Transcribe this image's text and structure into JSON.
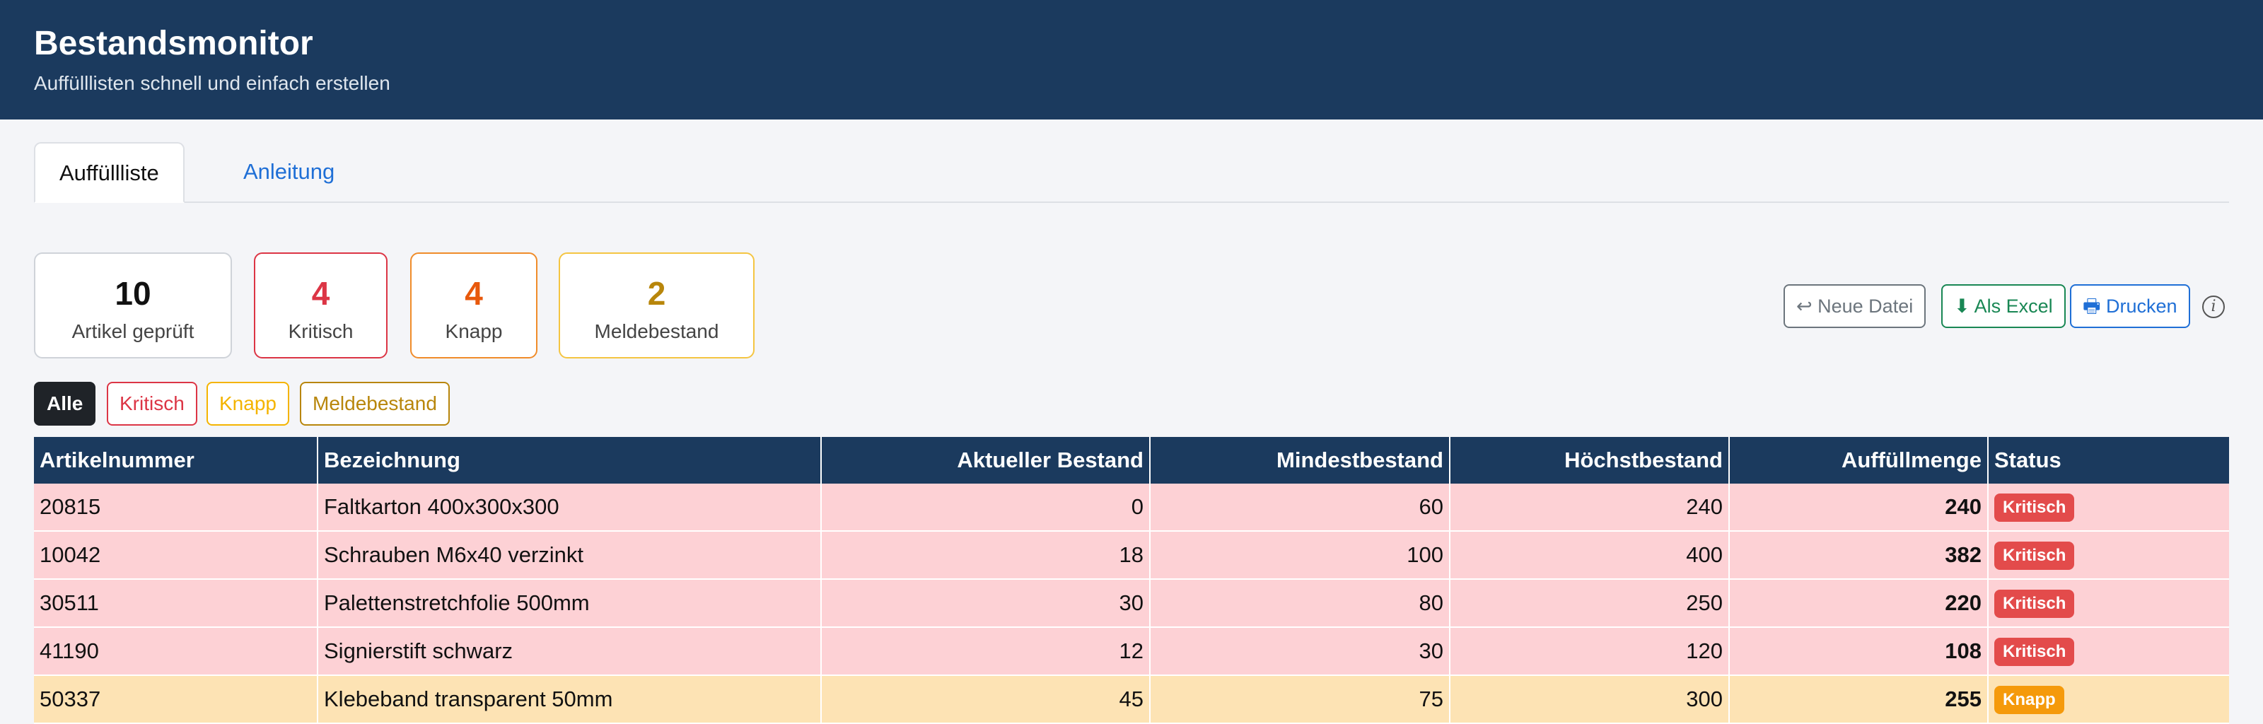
{
  "header": {
    "title": "Bestandsmonitor",
    "subtitle": "Auffülllisten schnell und einfach erstellen"
  },
  "tabs": [
    {
      "label": "Auffüllliste",
      "active": true
    },
    {
      "label": "Anleitung",
      "active": false
    }
  ],
  "summary": [
    {
      "value": "10",
      "label": "Artikel geprüft",
      "color": "#111111",
      "border": "#cfd3d9"
    },
    {
      "value": "4",
      "label": "Kritisch",
      "color": "#dc3545",
      "border": "#dc3545"
    },
    {
      "value": "4",
      "label": "Knapp",
      "color": "#e8590c",
      "border": "#f08c2a"
    },
    {
      "value": "2",
      "label": "Meldebestand",
      "color": "#b8860b",
      "border": "#f4c542"
    }
  ],
  "filters": [
    {
      "label": "Alle",
      "active": true
    },
    {
      "label": "Kritisch",
      "color": "#dc3545"
    },
    {
      "label": "Knapp",
      "color": "#f4b400"
    },
    {
      "label": "Meldebestand",
      "color": "#b8860b"
    }
  ],
  "actions": {
    "new_file": "↩ Neue Datei",
    "excel": "⬇ Als Excel",
    "print": "🖶 Drucken",
    "info": "i"
  },
  "table": {
    "columns": [
      "Artikelnummer",
      "Bezeichnung",
      "Aktueller Bestand",
      "Mindestbestand",
      "Höchstbestand",
      "Auffüllmenge",
      "Status"
    ],
    "rows": [
      {
        "id": "20815",
        "name": "Faltkarton 400x300x300",
        "current": "0",
        "min": "60",
        "max": "240",
        "fill": "240",
        "status": "Kritisch",
        "level": "kritisch"
      },
      {
        "id": "10042",
        "name": "Schrauben M6x40 verzinkt",
        "current": "18",
        "min": "100",
        "max": "400",
        "fill": "382",
        "status": "Kritisch",
        "level": "kritisch"
      },
      {
        "id": "30511",
        "name": "Palettenstretchfolie 500mm",
        "current": "30",
        "min": "80",
        "max": "250",
        "fill": "220",
        "status": "Kritisch",
        "level": "kritisch"
      },
      {
        "id": "41190",
        "name": "Signierstift schwarz",
        "current": "12",
        "min": "30",
        "max": "120",
        "fill": "108",
        "status": "Kritisch",
        "level": "kritisch"
      },
      {
        "id": "50337",
        "name": "Klebeband transparent 50mm",
        "current": "45",
        "min": "75",
        "max": "300",
        "fill": "255",
        "status": "Knapp",
        "level": "knapp"
      }
    ]
  },
  "colors": {
    "header_bg": "#1b3a5e",
    "kritisch_badge": "#e34b4b",
    "knapp_badge": "#f59a0b",
    "link": "#1f6fd6"
  }
}
